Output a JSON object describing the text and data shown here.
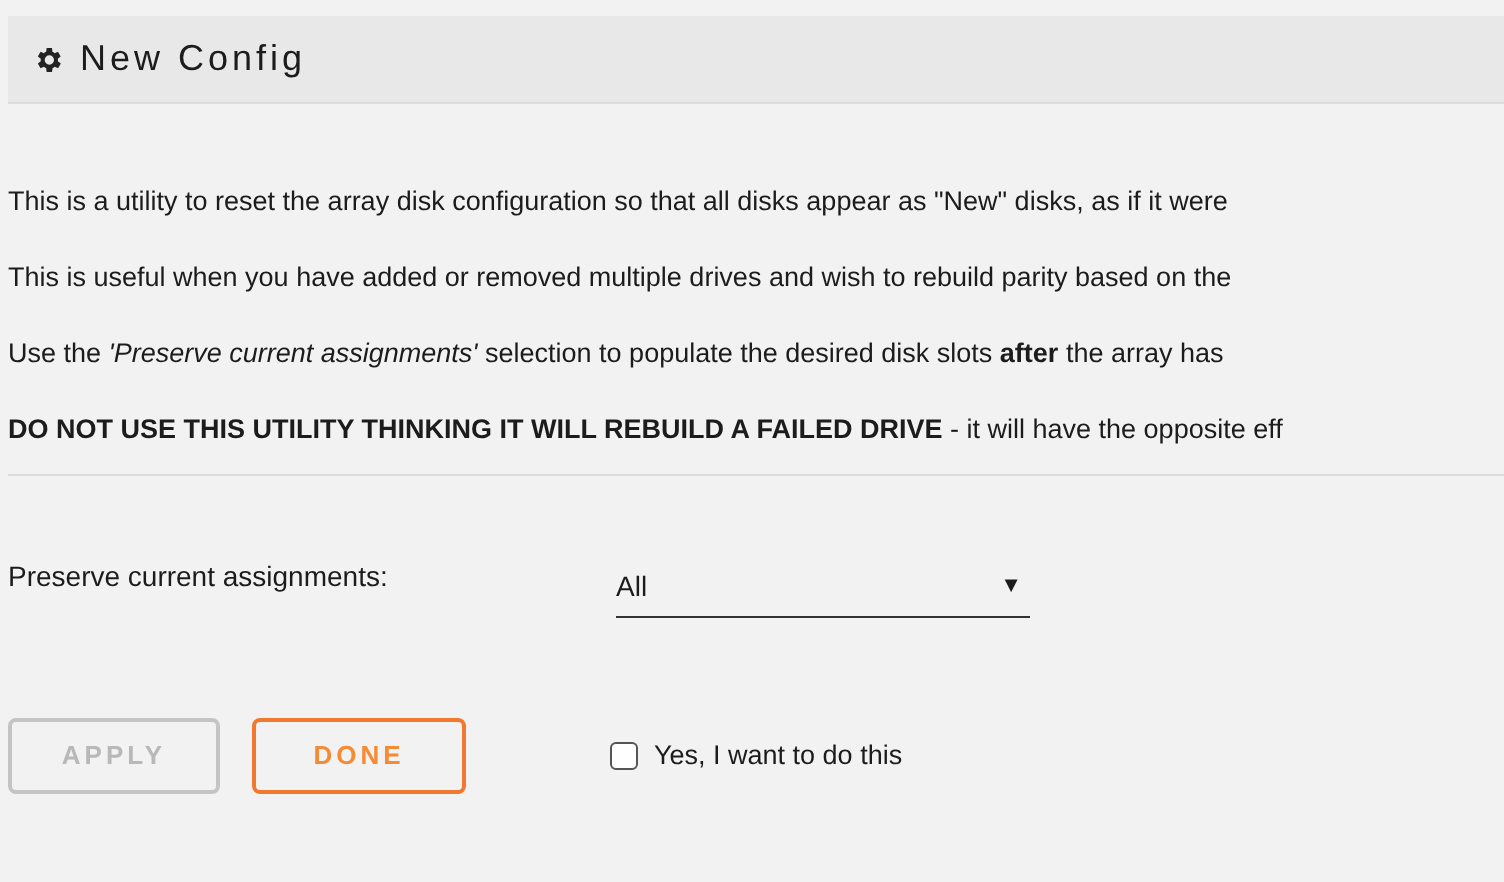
{
  "header": {
    "title": "New Config"
  },
  "paragraphs": [
    "This is a utility to reset the array disk configuration so that all disks appear as \"New\" disks, as if it were",
    "This is useful when you have added or removed multiple drives and wish to rebuild parity based on the",
    "Use the *'Preserve current assignments'* selection to populate the desired disk slots **after** the array has",
    "**DO NOT USE THIS UTILITY THINKING IT WILL REBUILD A FAILED DRIVE** - it will have the opposite eff"
  ],
  "preserve": {
    "label": "Preserve current assignments:",
    "value": "All",
    "arrow": "▼"
  },
  "buttons": [
    {
      "label": "APPLY",
      "disabled": true
    },
    {
      "label": "DONE",
      "disabled": false
    }
  ],
  "confirm": {
    "label": "Yes, I want to do this",
    "checked": false
  }
}
